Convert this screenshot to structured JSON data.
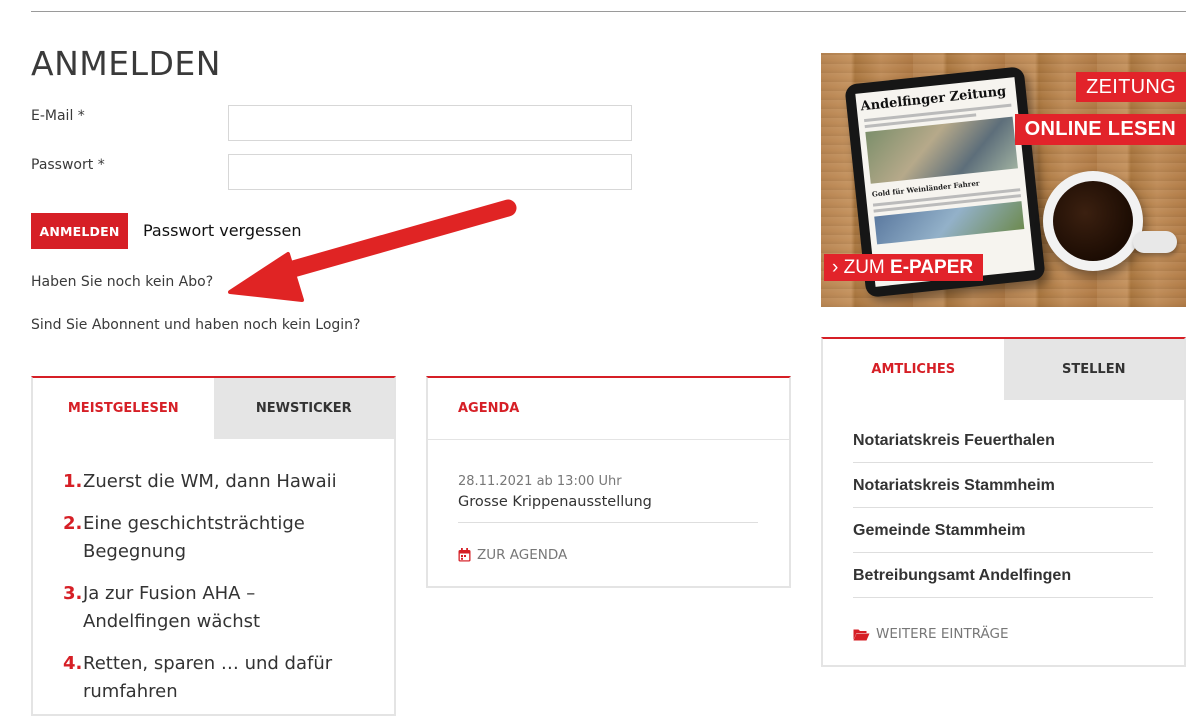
{
  "login": {
    "title": "ANMELDEN",
    "email_label": "E-Mail *",
    "email_value": "",
    "password_label": "Passwort *",
    "password_value": "",
    "submit_label": "ANMELDEN",
    "forgot_label": "Passwort vergessen",
    "no_subscription": "Haben Sie noch kein Abo?",
    "subscriber_no_login": "Sind Sie Abonnent und haben noch kein Login?"
  },
  "ad": {
    "newspaper_title": "Andelfinger Zeitung",
    "headline": "Gold für Weinländer Fahrer",
    "line1": "ZEITUNG",
    "line2": "ONLINE LESEN",
    "cta_arrow": "›",
    "cta_prefix": "ZUM",
    "cta_bold": "E-PAPER"
  },
  "news_panel": {
    "tabs": [
      "MEISTGELESEN",
      "NEWSTICKER"
    ],
    "items": [
      {
        "num": "1.",
        "text": "Zuerst die WM, dann Hawaii"
      },
      {
        "num": "2.",
        "text": "Eine geschichtsträchtige Begegnung"
      },
      {
        "num": "3.",
        "text": "Ja zur Fusion AHA – Andelfingen wächst"
      },
      {
        "num": "4.",
        "text": "Retten, sparen … und dafür rumfahren"
      }
    ]
  },
  "agenda_panel": {
    "tab": "AGENDA",
    "event_date": "28.11.2021 ab 13:00 Uhr",
    "event_title": "Grosse Krippenausstellung",
    "more_label": "ZUR AGENDA"
  },
  "official_panel": {
    "tabs": [
      "AMTLICHES",
      "STELLEN"
    ],
    "items": [
      "Notariatskreis Feuerthalen",
      "Notariatskreis Stammheim",
      "Gemeinde Stammheim",
      "Betreibungsamt Andelfingen"
    ],
    "more_label": "WEITERE EINTRÄGE"
  },
  "colors": {
    "accent": "#d61f26",
    "arrow": "#e02424",
    "tab_inactive": "#e5e5e5"
  },
  "icons": {
    "calendar": "calendar-icon",
    "folder": "folder-open-icon"
  }
}
